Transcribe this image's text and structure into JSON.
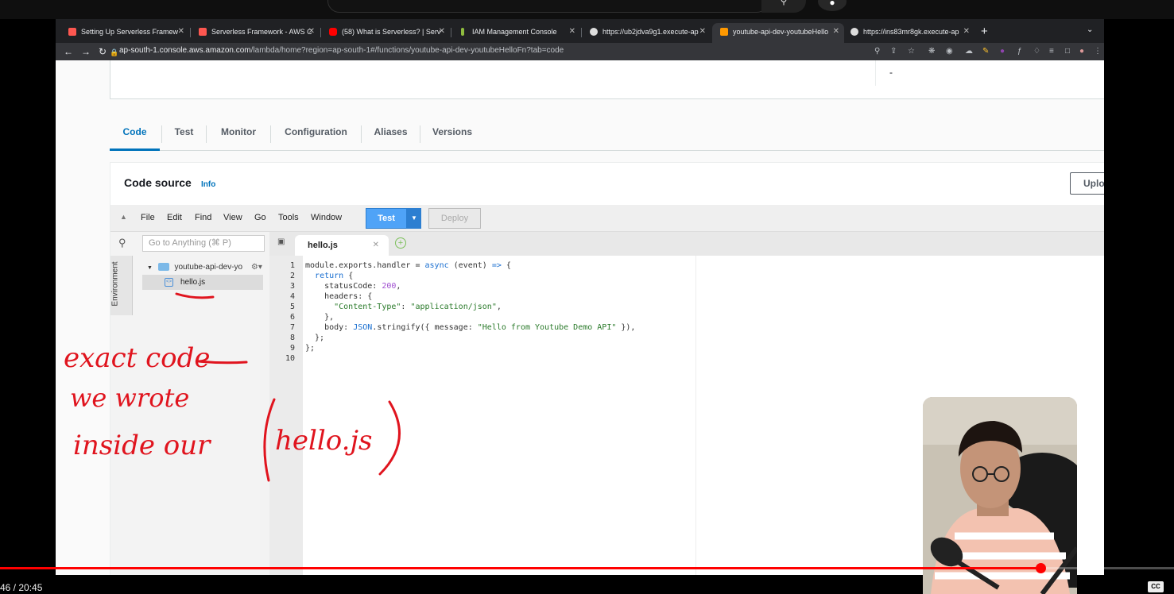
{
  "browser": {
    "tabs": [
      {
        "title": "Setting Up Serverless Framew",
        "favicon_color": "#fd5750"
      },
      {
        "title": "Serverless Framework - AWS C",
        "favicon_color": "#fd5750"
      },
      {
        "title": "(58) What is Serverless? | Serv",
        "favicon_color": "#ff0000"
      },
      {
        "title": "IAM Management Console",
        "favicon_color": "#8fbc3f"
      },
      {
        "title": "https://ub2jdva9g1.execute-ap",
        "favicon_color": "#dddddd"
      },
      {
        "title": "youtube-api-dev-youtubeHello",
        "favicon_color": "#ff9900"
      },
      {
        "title": "https://ins83mr8gk.execute-ap",
        "favicon_color": "#dddddd"
      }
    ],
    "active_tab_index": 5,
    "url_host": "ap-south-1.console.aws.amazon.com",
    "url_path": "/lambda/home?region=ap-south-1#/functions/youtube-api-dev-youtubeHelloFn?tab=code"
  },
  "page": {
    "summary_value": "-",
    "tabs": [
      "Code",
      "Test",
      "Monitor",
      "Configuration",
      "Aliases",
      "Versions"
    ],
    "active_tab": "Code",
    "code_source_title": "Code source",
    "info_link": "Info",
    "upload_label": "Uplo"
  },
  "ide": {
    "menu": [
      "File",
      "Edit",
      "Find",
      "View",
      "Go",
      "Tools",
      "Window"
    ],
    "test_label": "Test",
    "deploy_label": "Deploy",
    "goto_placeholder": "Go to Anything (⌘ P)",
    "environment_label": "Environment",
    "folder_name": "youtube-api-dev-yo",
    "file_name": "hello.js",
    "open_tab": "hello.js",
    "code_lines": [
      "module.exports.handler = async (event) => {",
      "  return {",
      "    statusCode: 200,",
      "    headers: {",
      "      \"Content-Type\": \"application/json\",",
      "    },",
      "    body: JSON.stringify({ message: \"Hello from Youtube Demo API\" }),",
      "  };",
      "};",
      ""
    ]
  },
  "annotation": {
    "handwriting": "exact code we wrote inside our (hello.js)",
    "ink_color": "#e0141e"
  },
  "player": {
    "progress": 0.886,
    "time": "46 / 20:45",
    "cc_label": "CC"
  }
}
